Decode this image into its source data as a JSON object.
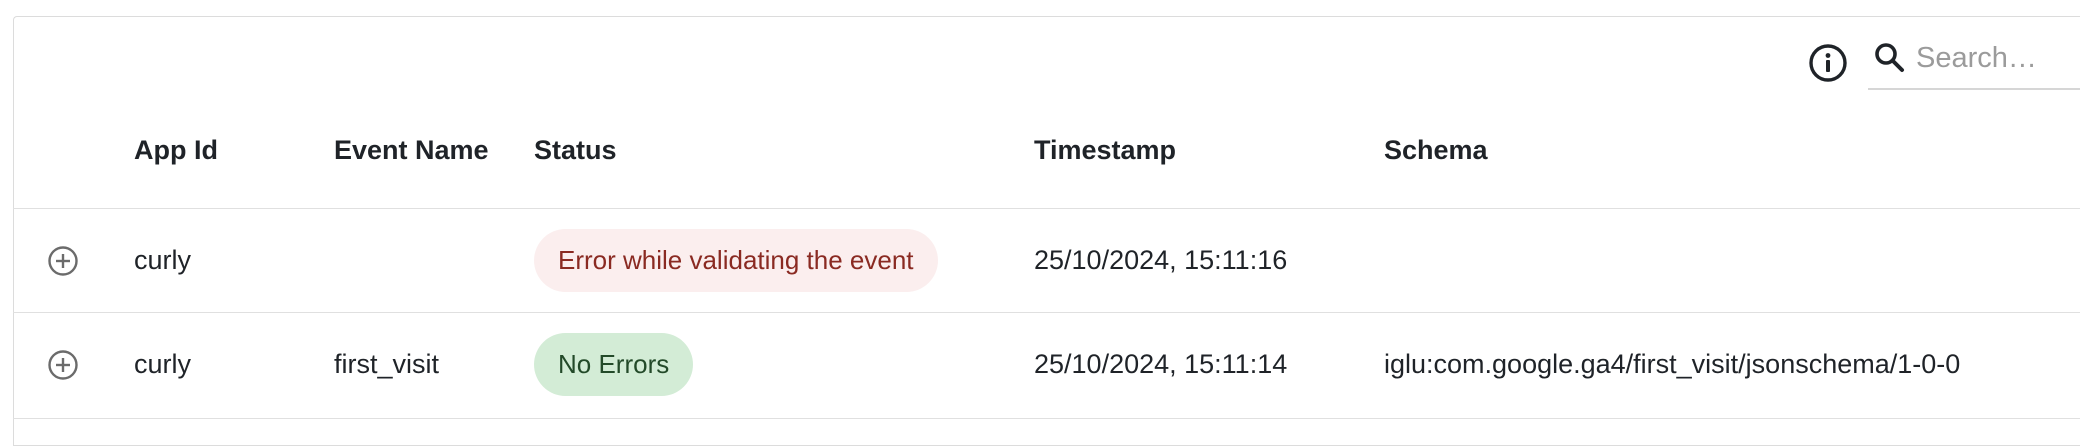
{
  "toolbar": {
    "search_placeholder": "Search…",
    "info_icon": "info-icon",
    "search_icon": "search-icon"
  },
  "table": {
    "columns": [
      "App Id",
      "Event Name",
      "Status",
      "Timestamp",
      "Schema"
    ],
    "rows": [
      {
        "app_id": "curly",
        "event_name": "",
        "status": "Error while validating the event",
        "status_type": "error",
        "timestamp": "25/10/2024, 15:11:16",
        "schema": ""
      },
      {
        "app_id": "curly",
        "event_name": "first_visit",
        "status": "No Errors",
        "status_type": "ok",
        "timestamp": "25/10/2024, 15:11:14",
        "schema": "iglu:com.google.ga4/first_visit/jsonschema/1-0-0"
      }
    ]
  },
  "colors": {
    "error_chip_bg": "#fbeeee",
    "error_chip_text": "#8a2a22",
    "ok_chip_bg": "#d3ecd6",
    "ok_chip_text": "#234a29",
    "divider": "#e0e0e0"
  }
}
